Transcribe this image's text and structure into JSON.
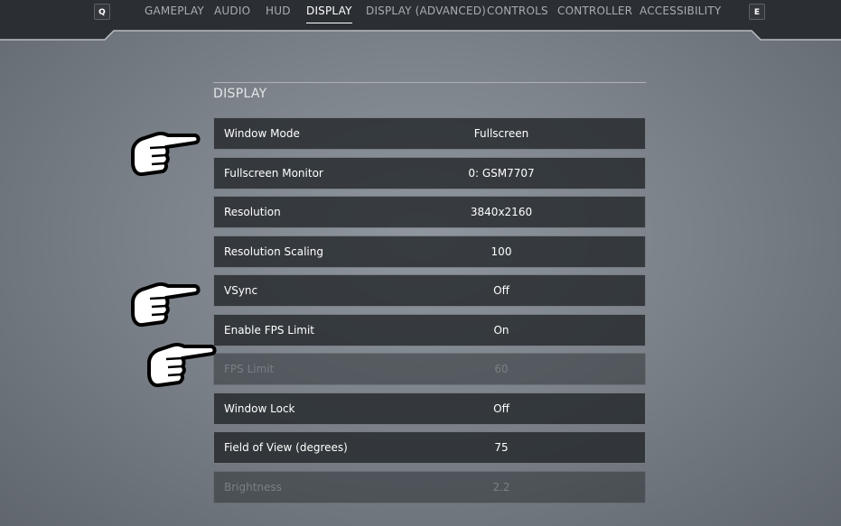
{
  "nav": {
    "left_key": "Q",
    "right_key": "E",
    "tabs": [
      {
        "label": "GAMEPLAY",
        "active": false
      },
      {
        "label": "AUDIO",
        "active": false
      },
      {
        "label": "HUD",
        "active": false
      },
      {
        "label": "DISPLAY",
        "active": true
      },
      {
        "label": "DISPLAY (ADVANCED)",
        "active": false
      },
      {
        "label": "CONTROLS",
        "active": false
      },
      {
        "label": "CONTROLLER",
        "active": false
      },
      {
        "label": "ACCESSIBILITY",
        "active": false
      }
    ]
  },
  "section": {
    "title": "DISPLAY"
  },
  "settings": [
    {
      "label": "Window Mode",
      "value": "Fullscreen",
      "enabled": true
    },
    {
      "label": "Fullscreen Monitor",
      "value": "0: GSM7707",
      "enabled": true
    },
    {
      "label": "Resolution",
      "value": "3840x2160",
      "enabled": true
    },
    {
      "label": "Resolution Scaling",
      "value": "100",
      "enabled": true
    },
    {
      "label": "VSync",
      "value": "Off",
      "enabled": true
    },
    {
      "label": "Enable FPS Limit",
      "value": "On",
      "enabled": true
    },
    {
      "label": "FPS Limit",
      "value": "60",
      "enabled": false
    },
    {
      "label": "Window Lock",
      "value": "Off",
      "enabled": true
    },
    {
      "label": "Field of View (degrees)",
      "value": "75",
      "enabled": true
    },
    {
      "label": "Brightness",
      "value": "2.2",
      "enabled": false
    }
  ],
  "colors": {
    "background": "#7b8289",
    "row_background": "#222529",
    "row_border": "#afb4ba",
    "active_text": "#ffffff",
    "inactive_tab_text": "#a8adb3",
    "disabled_text": "#7a7f85"
  },
  "icons": {
    "pointer": "pointing-hand-icon"
  }
}
